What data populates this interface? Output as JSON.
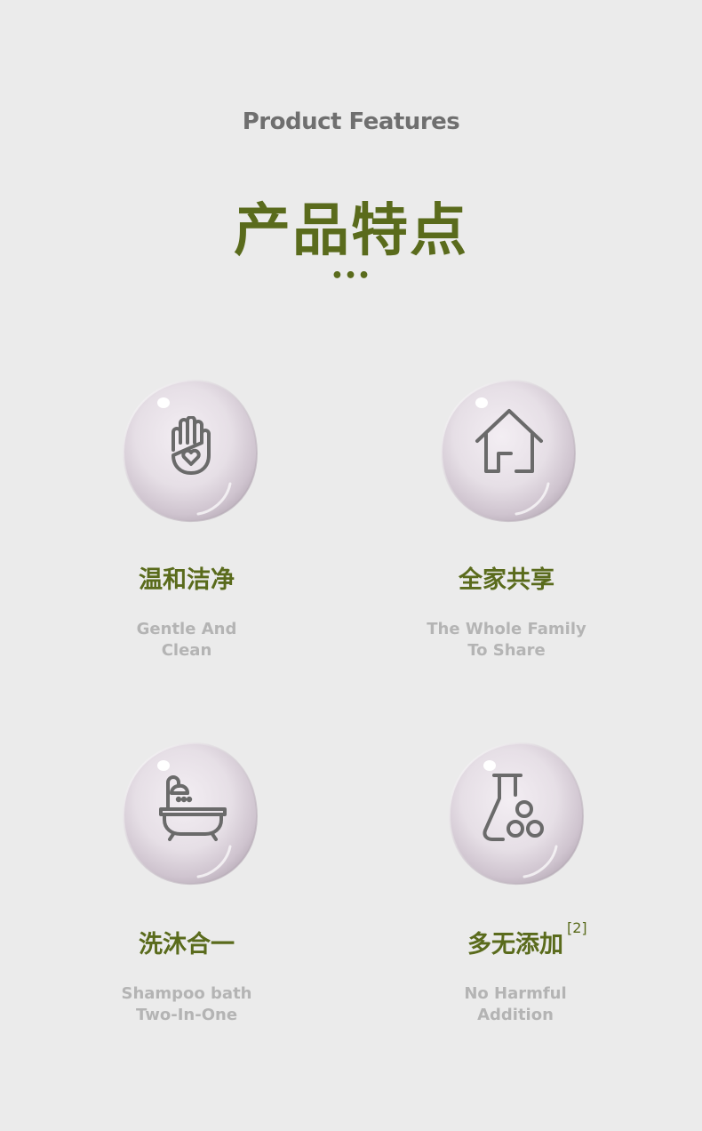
{
  "header": {
    "subtitle_en": "Product Features",
    "title_cn": "产品特点",
    "dots": "•••"
  },
  "features": [
    {
      "icon": "hand-heart-icon",
      "title_cn": "温和洁净",
      "line1": "Gentle And",
      "line2": "Clean"
    },
    {
      "icon": "house-icon",
      "title_cn": "全家共享",
      "line1": "The Whole Family",
      "line2": "To Share"
    },
    {
      "icon": "bathtub-shower-icon",
      "title_cn": "洗沐合一",
      "line1": "Shampoo bath",
      "line2": "Two-In-One"
    },
    {
      "icon": "flask-molecule-icon",
      "title_cn": "多无添加",
      "superscript": "[2]",
      "line1": "No Harmful",
      "line2": "Addition"
    }
  ],
  "colors": {
    "accent_green": "#5a6b1c",
    "heading_gray": "#6f6f6f",
    "caption_gray": "#b4b4b4",
    "icon_gray": "#6a6a6a",
    "background": "#ebebeb"
  }
}
